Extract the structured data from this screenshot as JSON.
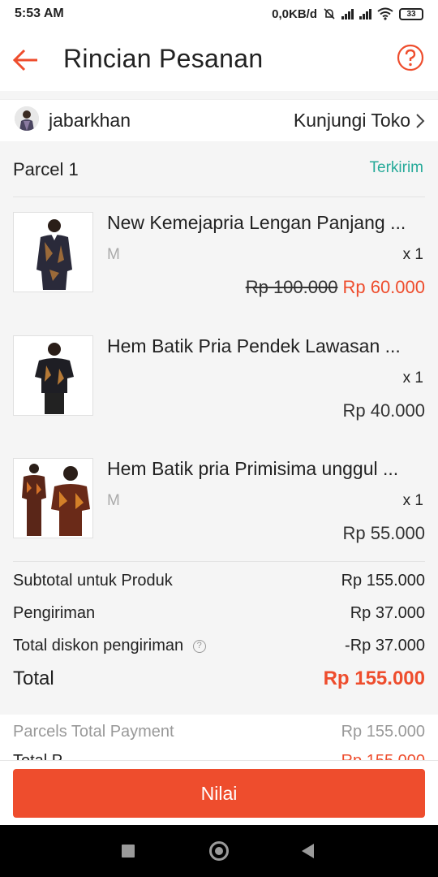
{
  "status_bar": {
    "time": "5:53 AM",
    "network_speed": "0,0KB/d",
    "battery": "33",
    "icons": [
      "alarm-off-icon",
      "signal-icon",
      "signal-icon",
      "wifi-icon",
      "battery-icon"
    ]
  },
  "header": {
    "title": "Rincian Pesanan",
    "back_icon": "arrow-left-icon",
    "help_icon": "question-circle-icon"
  },
  "shop": {
    "name": "jabarkhan",
    "visit_label": "Kunjungi Toko"
  },
  "parcel": {
    "title": "Parcel 1",
    "status": "Terkirim",
    "items": [
      {
        "name": "New Kemejapria Lengan Panjang ...",
        "variant": "M",
        "qty": "x 1",
        "old_price": "Rp 100.000",
        "price": "Rp 60.000"
      },
      {
        "name": "Hem Batik Pria Pendek Lawasan ...",
        "variant": "",
        "qty": "x 1",
        "old_price": "",
        "price": "Rp 40.000"
      },
      {
        "name": "Hem Batik pria Primisima unggul ...",
        "variant": "M",
        "qty": "x 1",
        "old_price": "",
        "price": "Rp 55.000"
      }
    ]
  },
  "summary": {
    "subtotal_label": "Subtotal untuk Produk",
    "subtotal_value": "Rp 155.000",
    "shipping_label": "Pengiriman",
    "shipping_value": "Rp 37.000",
    "shipping_discount_label": "Total diskon pengiriman",
    "shipping_discount_value": "-Rp 37.000",
    "total_label": "Total",
    "total_value": "Rp 155.000"
  },
  "payment": {
    "parcels_total_label": "Parcels Total Payment",
    "parcels_total_value": "Rp 155.000",
    "total_payment_label": "Total P",
    "total_payment_value": "Rp 155.000"
  },
  "actions": {
    "rate_label": "Nilai"
  },
  "colors": {
    "accent": "#ee4d2d",
    "status_green": "#26aa99"
  }
}
